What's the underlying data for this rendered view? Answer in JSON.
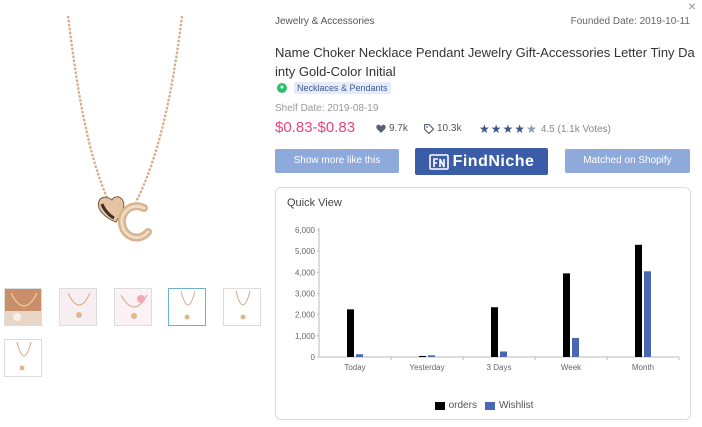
{
  "product": {
    "category": "Jewelry & Accessories",
    "founded_date": "Founded Date: 2019-10-11",
    "title": "Name Choker Necklace Pendant Jewelry Gift-Accessories Letter Tiny Dainty Gold-Color Initial",
    "subcategory_tag": "Necklaces & Pendants",
    "shelf_date": "Shelf Date: 2019-08-19",
    "price": "$0.83-$0.83",
    "likes": "9.7k",
    "tags": "10.3k",
    "rating_text": "4.5 (1.1k Votes)",
    "rating": 4.5
  },
  "buttons": {
    "show_more": "Show more like this",
    "findniche_logo": "FindNiche",
    "matched_shopify": "Matched on Shopify"
  },
  "gallery": {
    "thumbnail_count": 6,
    "selected_index": 3
  },
  "quick_view": {
    "title": "Quick View"
  },
  "colors": {
    "price": "#e8467c",
    "button": "#8eaadb",
    "brand": "#3b5da8",
    "orders": "#000000",
    "wishlist": "#4a67b3"
  },
  "chart_data": {
    "type": "bar",
    "categories": [
      "Today",
      "Yesterday",
      "3 Days",
      "Week",
      "Month"
    ],
    "series": [
      {
        "name": "orders",
        "values": [
          2250,
          50,
          2350,
          3950,
          5300
        ]
      },
      {
        "name": "Wishlist",
        "values": [
          130,
          80,
          260,
          900,
          4050
        ]
      }
    ],
    "yticks": [
      "0",
      "1,000",
      "2,000",
      "3,000",
      "4,000",
      "5,000",
      "6,000"
    ],
    "ylim": [
      0,
      6000
    ],
    "legend": "bottom-center"
  }
}
